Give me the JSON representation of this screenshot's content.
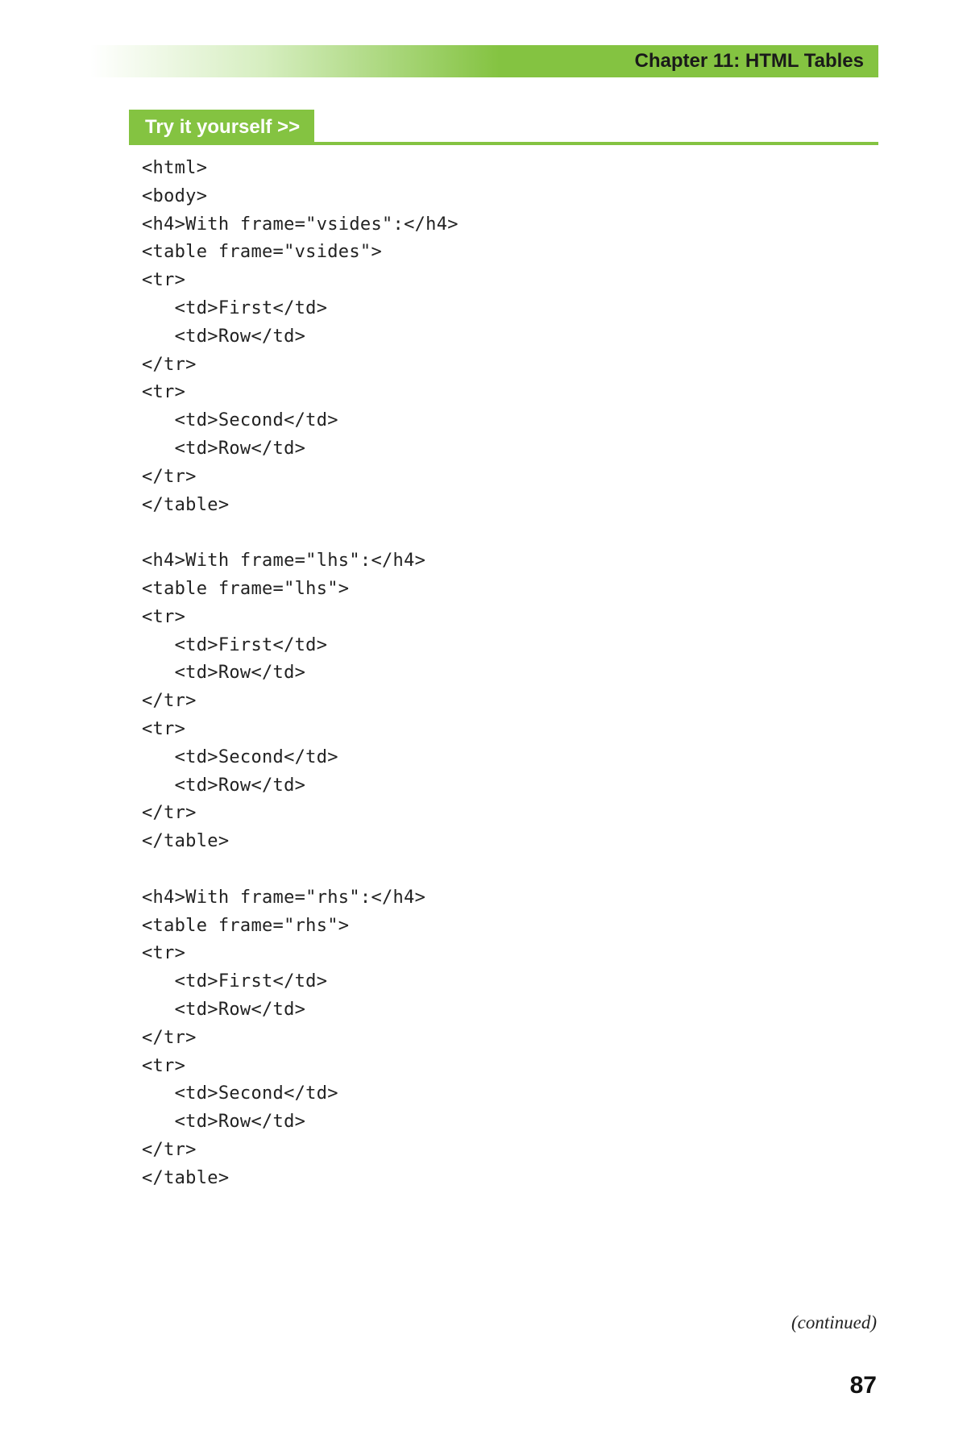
{
  "chapter_title": "Chapter 11: HTML Tables",
  "try_label": "Try it yourself >>",
  "code": "<html>\n<body>\n<h4>With frame=\"vsides\":</h4>\n<table frame=\"vsides\">\n<tr>\n   <td>First</td>\n   <td>Row</td>\n</tr>\n<tr>\n   <td>Second</td>\n   <td>Row</td>\n</tr>\n</table>\n\n<h4>With frame=\"lhs\":</h4>\n<table frame=\"lhs\">\n<tr>\n   <td>First</td>\n   <td>Row</td>\n</tr>\n<tr>\n   <td>Second</td>\n   <td>Row</td>\n</tr>\n</table>\n\n<h4>With frame=\"rhs\":</h4>\n<table frame=\"rhs\">\n<tr>\n   <td>First</td>\n   <td>Row</td>\n</tr>\n<tr>\n   <td>Second</td>\n   <td>Row</td>\n</tr>\n</table>",
  "continued": "(continued)",
  "page_number": "87"
}
